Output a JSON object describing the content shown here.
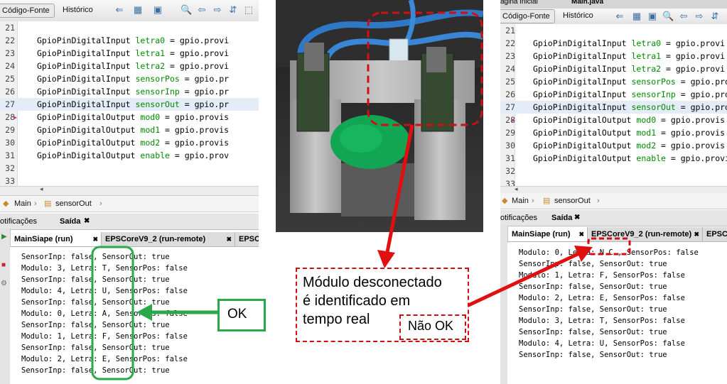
{
  "left": {
    "toolbar": {
      "tab_source": "Código-Fonte",
      "tab_history": "Histórico"
    },
    "code_lines": [
      {
        "num": "21",
        "type": "",
        "var": "",
        "rest": ""
      },
      {
        "num": "22",
        "type": "GpioPinDigitalInput",
        "var": "letra0",
        "rest": " = gpio.provi"
      },
      {
        "num": "23",
        "type": "GpioPinDigitalInput",
        "var": "letra1",
        "rest": " = gpio.provi"
      },
      {
        "num": "24",
        "type": "GpioPinDigitalInput",
        "var": "letra2",
        "rest": " = gpio.provi"
      },
      {
        "num": "25",
        "type": "GpioPinDigitalInput",
        "var": "sensorPos",
        "rest": " = gpio.pr"
      },
      {
        "num": "26",
        "type": "GpioPinDigitalInput",
        "var": "sensorInp",
        "rest": " = gpio.pr"
      },
      {
        "num": "27",
        "type": "GpioPinDigitalInput",
        "var": "sensorOut",
        "rest": " = gpio.pr"
      },
      {
        "num": "28",
        "type": "GpioPinDigitalOutput",
        "var": "mod0",
        "rest": " = gpio.provis"
      },
      {
        "num": "29",
        "type": "GpioPinDigitalOutput",
        "var": "mod1",
        "rest": " = gpio.provis"
      },
      {
        "num": "30",
        "type": "GpioPinDigitalOutput",
        "var": "mod2",
        "rest": " = gpio.provis"
      },
      {
        "num": "31",
        "type": "GpioPinDigitalOutput",
        "var": "enable",
        "rest": " = gpio.prov"
      },
      {
        "num": "32",
        "type": "",
        "var": "",
        "rest": ""
      },
      {
        "num": "33",
        "type": "",
        "var": "",
        "rest": ""
      }
    ],
    "breadcrumb": {
      "item1": "Main",
      "item2": "sensorOut"
    },
    "output_header": {
      "notifications": "otificações",
      "output": "Saída"
    },
    "output_tabs": [
      "MainSiape (run)",
      "EPSCoreV9_2 (run-remote)",
      "EPSCore"
    ],
    "console": [
      "SensorInp: false, SensorOut: true",
      "Modulo: 3, Letra: T, SensorPos: false",
      "SensorInp: false, SensorOut: true",
      "Modulo: 4, Letra: U, SensorPos: false",
      "SensorInp: false, SensorOut: true",
      "Modulo: 0, Letra: A, SensorPos: false",
      "SensorInp: false, SensorOut: true",
      "Modulo: 1, Letra: F, SensorPos: false",
      "SensorInp: false, SensorOut: true",
      "Modulo: 2, Letra: E, SensorPos: false",
      "SensorInp: false, SensorOut: true"
    ]
  },
  "right": {
    "toolbar": {
      "tab_top1": "ágina Inicial",
      "tab_top2": "Main.java",
      "tab_source": "Código-Fonte",
      "tab_history": "Histórico"
    },
    "code_lines": [
      {
        "num": "21",
        "type": "",
        "var": "",
        "rest": ""
      },
      {
        "num": "22",
        "type": "GpioPinDigitalInput",
        "var": "letra0",
        "rest": " = gpio.provi"
      },
      {
        "num": "23",
        "type": "GpioPinDigitalInput",
        "var": "letra1",
        "rest": " = gpio.provi"
      },
      {
        "num": "24",
        "type": "GpioPinDigitalInput",
        "var": "letra2",
        "rest": " = gpio.provi"
      },
      {
        "num": "25",
        "type": "GpioPinDigitalInput",
        "var": "sensorPos",
        "rest": " = gpio.pro"
      },
      {
        "num": "26",
        "type": "GpioPinDigitalInput",
        "var": "sensorInp",
        "rest": " = gpio.pro"
      },
      {
        "num": "27",
        "type": "GpioPinDigitalInput",
        "var": "sensorOut",
        "rest": " = gpio.pro"
      },
      {
        "num": "28",
        "type": "GpioPinDigitalOutput",
        "var": "mod0",
        "rest": " = gpio.provis"
      },
      {
        "num": "29",
        "type": "GpioPinDigitalOutput",
        "var": "mod1",
        "rest": " = gpio.provis"
      },
      {
        "num": "30",
        "type": "GpioPinDigitalOutput",
        "var": "mod2",
        "rest": " = gpio.provis"
      },
      {
        "num": "31",
        "type": "GpioPinDigitalOutput",
        "var": "enable",
        "rest": " = gpio.provi"
      },
      {
        "num": "32",
        "type": "",
        "var": "",
        "rest": ""
      },
      {
        "num": "33",
        "type": "",
        "var": "",
        "rest": ""
      }
    ],
    "breadcrumb": {
      "item1": "Main",
      "item2": "sensorOut"
    },
    "output_header": {
      "notifications": "otificações",
      "output": "Saída"
    },
    "output_tabs": [
      "MainSiape (run)",
      "EPSCoreV9_2 (run-remote)",
      "EPSCor"
    ],
    "console": [
      "Modulo: 0, Letra: N.C., SensorPos: false",
      "SensorInp: false, SensorOut: true",
      "Modulo: 1, Letra: F, SensorPos: false",
      "SensorInp: false, SensorOut: true",
      "Modulo: 2, Letra: E, SensorPos: false",
      "SensorInp: false, SensorOut: true",
      "Modulo: 3, Letra: T, SensorPos: false",
      "SensorInp: false, SensorOut: true",
      "Modulo: 4, Letra: U, SensorPos: false",
      "SensorInp: false, SensorOut: true"
    ]
  },
  "annotations": {
    "ok_label": "OK",
    "desc_line1": "Módulo desconectado",
    "desc_line2": "é identificado em",
    "desc_line3": "tempo real",
    "not_ok_label": "Não OK"
  },
  "colors": {
    "ok_green": "#2aa84a",
    "alert_red": "#d01010",
    "var_green": "#008a00"
  }
}
